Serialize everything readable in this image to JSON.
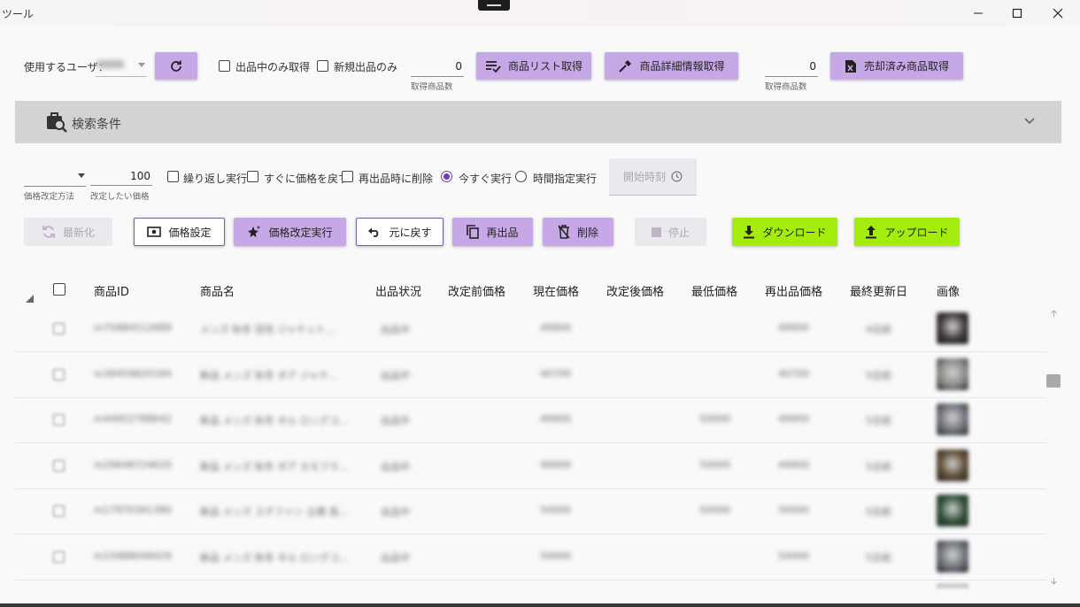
{
  "window": {
    "title": "ツール"
  },
  "toolbar": {
    "user_label": "使用するユーザ：",
    "user_value": "",
    "listing_only": "出品中のみ取得",
    "new_listing_only": "新規出品のみ",
    "count1_value": "0",
    "count1_caption": "取得商品数",
    "get_list": "商品リスト取得",
    "get_details": "商品詳細情報取得",
    "count2_value": "0",
    "count2_caption": "取得商品数",
    "get_sold": "売却済み商品取得"
  },
  "search_panel": {
    "title": "検索条件"
  },
  "options": {
    "method_caption": "価格改定方法",
    "method_value": "",
    "target_price_value": "100",
    "target_price_caption": "改定したい価格",
    "repeat": "繰り返し実行",
    "revert_immediately": "すぐに価格を戻す",
    "delete_on_relist": "再出品時に削除",
    "run_now": "今すぐ実行",
    "scheduled": "時間指定実行",
    "start_time": "開始時刻"
  },
  "actions": {
    "refresh": "最新化",
    "price_setting": "価格設定",
    "price_execute": "価格改定実行",
    "undo": "元に戻す",
    "relist": "再出品",
    "delete": "削除",
    "stop": "停止",
    "download": "ダウンロード",
    "upload": "アップロード"
  },
  "table": {
    "headers": [
      "商品ID",
      "商品名",
      "出品状況",
      "改定前価格",
      "現在価格",
      "改定後価格",
      "最低価格",
      "再出品価格",
      "最終更新日",
      "画像"
    ],
    "rows": [
      {
        "id": "m75884512689",
        "name": "メンズ 秋冬 羽毛 ジャケット...",
        "status": "出品中",
        "before": "",
        "current": "49900",
        "after": "",
        "min": "",
        "relist": "49900",
        "updated": "4日前",
        "thumb": "#3a3636"
      },
      {
        "id": "m38459820184",
        "name": "新品 メンズ 秋冬 ボア ジャケ...",
        "status": "出品中",
        "before": "",
        "current": "40700",
        "after": "",
        "min": "",
        "relist": "40700",
        "updated": "5日前",
        "thumb": "#8a8a86"
      },
      {
        "id": "m44952788642",
        "name": "新品 メンズ 秋冬 ネル ロングコ...",
        "status": "出品中",
        "before": "",
        "current": "49900",
        "after": "",
        "min": "50000",
        "relist": "49900",
        "updated": "5日前",
        "thumb": "#6f747b"
      },
      {
        "id": "m29648724620",
        "name": "新品 メンズ 秋冬 ボア カモフラ...",
        "status": "出品中",
        "before": "",
        "current": "49900",
        "after": "",
        "min": "50000",
        "relist": "49900",
        "updated": "5日前",
        "thumb": "#5b4a33"
      },
      {
        "id": "m17970391380",
        "name": "新品 メンズ ステファン 立襟 長...",
        "status": "出品中",
        "before": "",
        "current": "50000",
        "after": "",
        "min": "50000",
        "relist": "50000",
        "updated": "5日前",
        "thumb": "#2f4e35"
      },
      {
        "id": "m15988048429",
        "name": "新品 メンズ 秋冬 ネル ロングコ...",
        "status": "出品中",
        "before": "",
        "current": "50000",
        "after": "",
        "min": "",
        "relist": "50000",
        "updated": "5日前",
        "thumb": "#6b7078"
      }
    ]
  },
  "colors": {
    "accent_purple": "#c7a8e6",
    "accent_green": "#a3ec0d",
    "radio_selected": "#6c3fb5"
  }
}
